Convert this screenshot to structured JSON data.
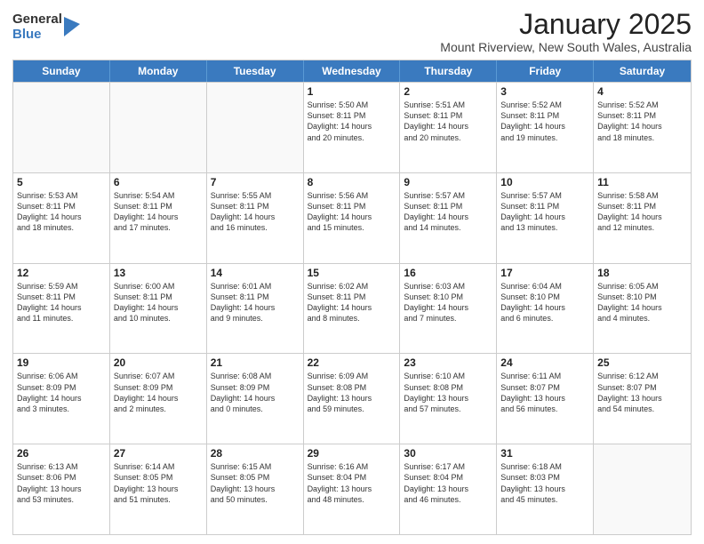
{
  "logo": {
    "general": "General",
    "blue": "Blue"
  },
  "header": {
    "month": "January 2025",
    "location": "Mount Riverview, New South Wales, Australia"
  },
  "days": [
    "Sunday",
    "Monday",
    "Tuesday",
    "Wednesday",
    "Thursday",
    "Friday",
    "Saturday"
  ],
  "weeks": [
    [
      {
        "day": "",
        "text": ""
      },
      {
        "day": "",
        "text": ""
      },
      {
        "day": "",
        "text": ""
      },
      {
        "day": "1",
        "text": "Sunrise: 5:50 AM\nSunset: 8:11 PM\nDaylight: 14 hours\nand 20 minutes."
      },
      {
        "day": "2",
        "text": "Sunrise: 5:51 AM\nSunset: 8:11 PM\nDaylight: 14 hours\nand 20 minutes."
      },
      {
        "day": "3",
        "text": "Sunrise: 5:52 AM\nSunset: 8:11 PM\nDaylight: 14 hours\nand 19 minutes."
      },
      {
        "day": "4",
        "text": "Sunrise: 5:52 AM\nSunset: 8:11 PM\nDaylight: 14 hours\nand 18 minutes."
      }
    ],
    [
      {
        "day": "5",
        "text": "Sunrise: 5:53 AM\nSunset: 8:11 PM\nDaylight: 14 hours\nand 18 minutes."
      },
      {
        "day": "6",
        "text": "Sunrise: 5:54 AM\nSunset: 8:11 PM\nDaylight: 14 hours\nand 17 minutes."
      },
      {
        "day": "7",
        "text": "Sunrise: 5:55 AM\nSunset: 8:11 PM\nDaylight: 14 hours\nand 16 minutes."
      },
      {
        "day": "8",
        "text": "Sunrise: 5:56 AM\nSunset: 8:11 PM\nDaylight: 14 hours\nand 15 minutes."
      },
      {
        "day": "9",
        "text": "Sunrise: 5:57 AM\nSunset: 8:11 PM\nDaylight: 14 hours\nand 14 minutes."
      },
      {
        "day": "10",
        "text": "Sunrise: 5:57 AM\nSunset: 8:11 PM\nDaylight: 14 hours\nand 13 minutes."
      },
      {
        "day": "11",
        "text": "Sunrise: 5:58 AM\nSunset: 8:11 PM\nDaylight: 14 hours\nand 12 minutes."
      }
    ],
    [
      {
        "day": "12",
        "text": "Sunrise: 5:59 AM\nSunset: 8:11 PM\nDaylight: 14 hours\nand 11 minutes."
      },
      {
        "day": "13",
        "text": "Sunrise: 6:00 AM\nSunset: 8:11 PM\nDaylight: 14 hours\nand 10 minutes."
      },
      {
        "day": "14",
        "text": "Sunrise: 6:01 AM\nSunset: 8:11 PM\nDaylight: 14 hours\nand 9 minutes."
      },
      {
        "day": "15",
        "text": "Sunrise: 6:02 AM\nSunset: 8:11 PM\nDaylight: 14 hours\nand 8 minutes."
      },
      {
        "day": "16",
        "text": "Sunrise: 6:03 AM\nSunset: 8:10 PM\nDaylight: 14 hours\nand 7 minutes."
      },
      {
        "day": "17",
        "text": "Sunrise: 6:04 AM\nSunset: 8:10 PM\nDaylight: 14 hours\nand 6 minutes."
      },
      {
        "day": "18",
        "text": "Sunrise: 6:05 AM\nSunset: 8:10 PM\nDaylight: 14 hours\nand 4 minutes."
      }
    ],
    [
      {
        "day": "19",
        "text": "Sunrise: 6:06 AM\nSunset: 8:09 PM\nDaylight: 14 hours\nand 3 minutes."
      },
      {
        "day": "20",
        "text": "Sunrise: 6:07 AM\nSunset: 8:09 PM\nDaylight: 14 hours\nand 2 minutes."
      },
      {
        "day": "21",
        "text": "Sunrise: 6:08 AM\nSunset: 8:09 PM\nDaylight: 14 hours\nand 0 minutes."
      },
      {
        "day": "22",
        "text": "Sunrise: 6:09 AM\nSunset: 8:08 PM\nDaylight: 13 hours\nand 59 minutes."
      },
      {
        "day": "23",
        "text": "Sunrise: 6:10 AM\nSunset: 8:08 PM\nDaylight: 13 hours\nand 57 minutes."
      },
      {
        "day": "24",
        "text": "Sunrise: 6:11 AM\nSunset: 8:07 PM\nDaylight: 13 hours\nand 56 minutes."
      },
      {
        "day": "25",
        "text": "Sunrise: 6:12 AM\nSunset: 8:07 PM\nDaylight: 13 hours\nand 54 minutes."
      }
    ],
    [
      {
        "day": "26",
        "text": "Sunrise: 6:13 AM\nSunset: 8:06 PM\nDaylight: 13 hours\nand 53 minutes."
      },
      {
        "day": "27",
        "text": "Sunrise: 6:14 AM\nSunset: 8:05 PM\nDaylight: 13 hours\nand 51 minutes."
      },
      {
        "day": "28",
        "text": "Sunrise: 6:15 AM\nSunset: 8:05 PM\nDaylight: 13 hours\nand 50 minutes."
      },
      {
        "day": "29",
        "text": "Sunrise: 6:16 AM\nSunset: 8:04 PM\nDaylight: 13 hours\nand 48 minutes."
      },
      {
        "day": "30",
        "text": "Sunrise: 6:17 AM\nSunset: 8:04 PM\nDaylight: 13 hours\nand 46 minutes."
      },
      {
        "day": "31",
        "text": "Sunrise: 6:18 AM\nSunset: 8:03 PM\nDaylight: 13 hours\nand 45 minutes."
      },
      {
        "day": "",
        "text": ""
      }
    ]
  ]
}
